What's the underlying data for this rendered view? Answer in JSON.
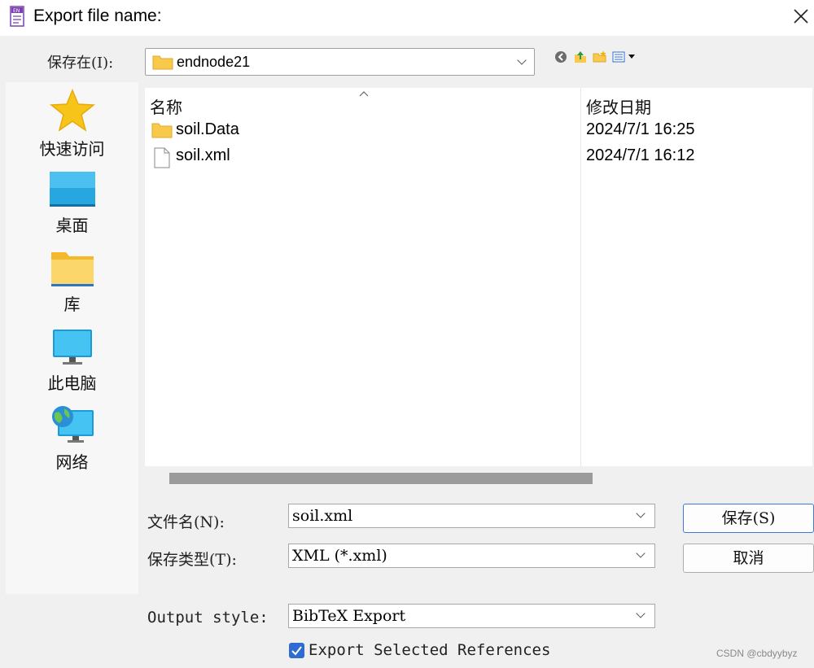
{
  "window": {
    "title": "Export file name:"
  },
  "lookin": {
    "label": "保存在(I):",
    "folder": "endnode21"
  },
  "places": [
    {
      "label": "快速访问",
      "icon": "star-icon"
    },
    {
      "label": "桌面",
      "icon": "desktop-icon"
    },
    {
      "label": "库",
      "icon": "library-folder-icon"
    },
    {
      "label": "此电脑",
      "icon": "computer-icon"
    },
    {
      "label": "网络",
      "icon": "network-icon"
    }
  ],
  "filelist": {
    "columns": {
      "name": "名称",
      "modified": "修改日期"
    },
    "rows": [
      {
        "name": "soil.Data",
        "date": "2024/7/1 16:25",
        "type": "folder"
      },
      {
        "name": "soil.xml",
        "date": "2024/7/1 16:12",
        "type": "file"
      }
    ]
  },
  "fields": {
    "filename": {
      "label": "文件名(N):",
      "value": "soil.xml"
    },
    "filetype": {
      "label": "保存类型(T):",
      "value": "XML (*.xml)"
    },
    "output_style": {
      "label": "Output style:",
      "value": "BibTeX Export"
    }
  },
  "buttons": {
    "save": "保存(S)",
    "cancel": "取消"
  },
  "export_selected": {
    "label": "Export Selected References",
    "checked": true
  },
  "watermark": "CSDN @cbdyybyz",
  "colors": {
    "accent": "#2f6bd0",
    "folder": "#f8c94a"
  }
}
